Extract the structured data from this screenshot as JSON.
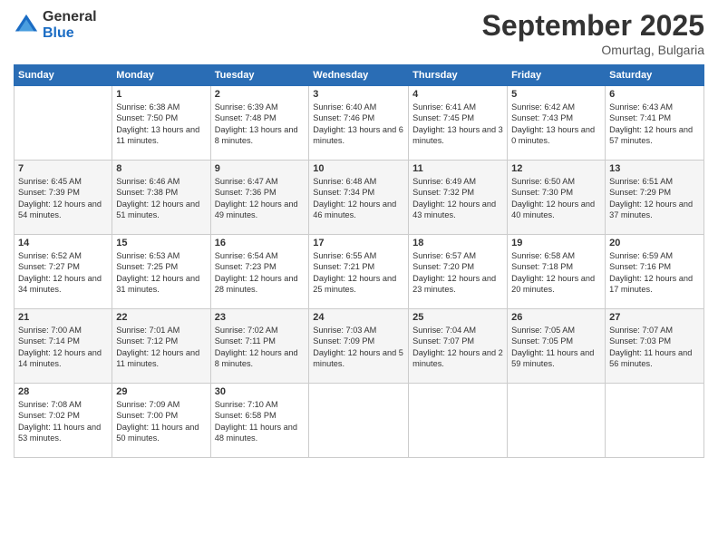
{
  "header": {
    "logo_general": "General",
    "logo_blue": "Blue",
    "month_title": "September 2025",
    "location": "Omurtag, Bulgaria"
  },
  "days_of_week": [
    "Sunday",
    "Monday",
    "Tuesday",
    "Wednesday",
    "Thursday",
    "Friday",
    "Saturday"
  ],
  "weeks": [
    [
      {
        "date": "",
        "sunrise": "",
        "sunset": "",
        "daylight": ""
      },
      {
        "date": "1",
        "sunrise": "Sunrise: 6:38 AM",
        "sunset": "Sunset: 7:50 PM",
        "daylight": "Daylight: 13 hours and 11 minutes."
      },
      {
        "date": "2",
        "sunrise": "Sunrise: 6:39 AM",
        "sunset": "Sunset: 7:48 PM",
        "daylight": "Daylight: 13 hours and 8 minutes."
      },
      {
        "date": "3",
        "sunrise": "Sunrise: 6:40 AM",
        "sunset": "Sunset: 7:46 PM",
        "daylight": "Daylight: 13 hours and 6 minutes."
      },
      {
        "date": "4",
        "sunrise": "Sunrise: 6:41 AM",
        "sunset": "Sunset: 7:45 PM",
        "daylight": "Daylight: 13 hours and 3 minutes."
      },
      {
        "date": "5",
        "sunrise": "Sunrise: 6:42 AM",
        "sunset": "Sunset: 7:43 PM",
        "daylight": "Daylight: 13 hours and 0 minutes."
      },
      {
        "date": "6",
        "sunrise": "Sunrise: 6:43 AM",
        "sunset": "Sunset: 7:41 PM",
        "daylight": "Daylight: 12 hours and 57 minutes."
      }
    ],
    [
      {
        "date": "7",
        "sunrise": "Sunrise: 6:45 AM",
        "sunset": "Sunset: 7:39 PM",
        "daylight": "Daylight: 12 hours and 54 minutes."
      },
      {
        "date": "8",
        "sunrise": "Sunrise: 6:46 AM",
        "sunset": "Sunset: 7:38 PM",
        "daylight": "Daylight: 12 hours and 51 minutes."
      },
      {
        "date": "9",
        "sunrise": "Sunrise: 6:47 AM",
        "sunset": "Sunset: 7:36 PM",
        "daylight": "Daylight: 12 hours and 49 minutes."
      },
      {
        "date": "10",
        "sunrise": "Sunrise: 6:48 AM",
        "sunset": "Sunset: 7:34 PM",
        "daylight": "Daylight: 12 hours and 46 minutes."
      },
      {
        "date": "11",
        "sunrise": "Sunrise: 6:49 AM",
        "sunset": "Sunset: 7:32 PM",
        "daylight": "Daylight: 12 hours and 43 minutes."
      },
      {
        "date": "12",
        "sunrise": "Sunrise: 6:50 AM",
        "sunset": "Sunset: 7:30 PM",
        "daylight": "Daylight: 12 hours and 40 minutes."
      },
      {
        "date": "13",
        "sunrise": "Sunrise: 6:51 AM",
        "sunset": "Sunset: 7:29 PM",
        "daylight": "Daylight: 12 hours and 37 minutes."
      }
    ],
    [
      {
        "date": "14",
        "sunrise": "Sunrise: 6:52 AM",
        "sunset": "Sunset: 7:27 PM",
        "daylight": "Daylight: 12 hours and 34 minutes."
      },
      {
        "date": "15",
        "sunrise": "Sunrise: 6:53 AM",
        "sunset": "Sunset: 7:25 PM",
        "daylight": "Daylight: 12 hours and 31 minutes."
      },
      {
        "date": "16",
        "sunrise": "Sunrise: 6:54 AM",
        "sunset": "Sunset: 7:23 PM",
        "daylight": "Daylight: 12 hours and 28 minutes."
      },
      {
        "date": "17",
        "sunrise": "Sunrise: 6:55 AM",
        "sunset": "Sunset: 7:21 PM",
        "daylight": "Daylight: 12 hours and 25 minutes."
      },
      {
        "date": "18",
        "sunrise": "Sunrise: 6:57 AM",
        "sunset": "Sunset: 7:20 PM",
        "daylight": "Daylight: 12 hours and 23 minutes."
      },
      {
        "date": "19",
        "sunrise": "Sunrise: 6:58 AM",
        "sunset": "Sunset: 7:18 PM",
        "daylight": "Daylight: 12 hours and 20 minutes."
      },
      {
        "date": "20",
        "sunrise": "Sunrise: 6:59 AM",
        "sunset": "Sunset: 7:16 PM",
        "daylight": "Daylight: 12 hours and 17 minutes."
      }
    ],
    [
      {
        "date": "21",
        "sunrise": "Sunrise: 7:00 AM",
        "sunset": "Sunset: 7:14 PM",
        "daylight": "Daylight: 12 hours and 14 minutes."
      },
      {
        "date": "22",
        "sunrise": "Sunrise: 7:01 AM",
        "sunset": "Sunset: 7:12 PM",
        "daylight": "Daylight: 12 hours and 11 minutes."
      },
      {
        "date": "23",
        "sunrise": "Sunrise: 7:02 AM",
        "sunset": "Sunset: 7:11 PM",
        "daylight": "Daylight: 12 hours and 8 minutes."
      },
      {
        "date": "24",
        "sunrise": "Sunrise: 7:03 AM",
        "sunset": "Sunset: 7:09 PM",
        "daylight": "Daylight: 12 hours and 5 minutes."
      },
      {
        "date": "25",
        "sunrise": "Sunrise: 7:04 AM",
        "sunset": "Sunset: 7:07 PM",
        "daylight": "Daylight: 12 hours and 2 minutes."
      },
      {
        "date": "26",
        "sunrise": "Sunrise: 7:05 AM",
        "sunset": "Sunset: 7:05 PM",
        "daylight": "Daylight: 11 hours and 59 minutes."
      },
      {
        "date": "27",
        "sunrise": "Sunrise: 7:07 AM",
        "sunset": "Sunset: 7:03 PM",
        "daylight": "Daylight: 11 hours and 56 minutes."
      }
    ],
    [
      {
        "date": "28",
        "sunrise": "Sunrise: 7:08 AM",
        "sunset": "Sunset: 7:02 PM",
        "daylight": "Daylight: 11 hours and 53 minutes."
      },
      {
        "date": "29",
        "sunrise": "Sunrise: 7:09 AM",
        "sunset": "Sunset: 7:00 PM",
        "daylight": "Daylight: 11 hours and 50 minutes."
      },
      {
        "date": "30",
        "sunrise": "Sunrise: 7:10 AM",
        "sunset": "Sunset: 6:58 PM",
        "daylight": "Daylight: 11 hours and 48 minutes."
      },
      {
        "date": "",
        "sunrise": "",
        "sunset": "",
        "daylight": ""
      },
      {
        "date": "",
        "sunrise": "",
        "sunset": "",
        "daylight": ""
      },
      {
        "date": "",
        "sunrise": "",
        "sunset": "",
        "daylight": ""
      },
      {
        "date": "",
        "sunrise": "",
        "sunset": "",
        "daylight": ""
      }
    ]
  ]
}
